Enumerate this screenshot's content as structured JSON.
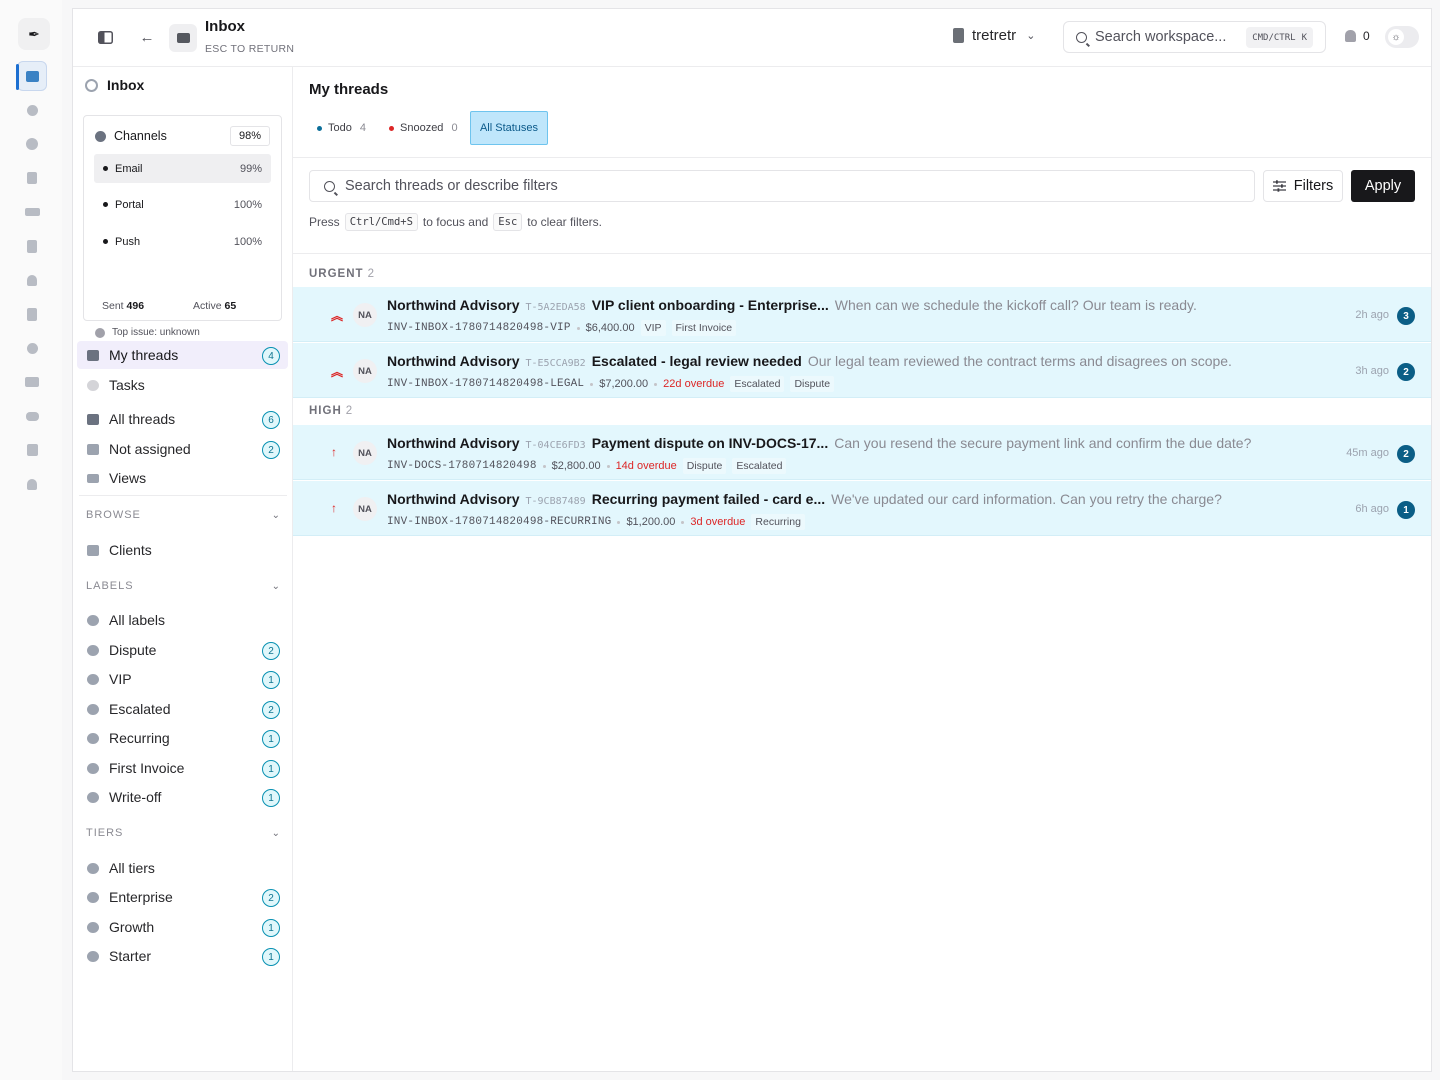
{
  "rail": {
    "logo": "✒",
    "items": [
      {
        "name": "inbox",
        "active": true
      },
      {
        "name": "wand"
      },
      {
        "name": "globe"
      },
      {
        "name": "copy"
      },
      {
        "name": "card"
      },
      {
        "name": "document"
      },
      {
        "name": "bell"
      },
      {
        "name": "invoice"
      },
      {
        "name": "clock"
      },
      {
        "name": "folder"
      },
      {
        "name": "users"
      },
      {
        "name": "calendar"
      },
      {
        "name": "bell-2"
      }
    ]
  },
  "header": {
    "title": "Inbox",
    "subtitle": "ESC TO RETURN",
    "workspace": "tretretr",
    "search_placeholder": "Search workspace...",
    "search_kbd_mod": "CMD/CTRL",
    "search_kbd_key": "K",
    "notifications": "0"
  },
  "sidebar": {
    "title": "Inbox",
    "channels": {
      "label": "Channels",
      "percent": "98%",
      "rows": [
        {
          "label": "Email",
          "value": "99%"
        },
        {
          "label": "Portal",
          "value": "100%"
        },
        {
          "label": "Push",
          "value": "100%"
        }
      ],
      "sent_label": "Sent",
      "sent_value": "496",
      "active_label": "Active",
      "active_value": "65",
      "top_issue": "Top issue: unknown"
    },
    "nav": [
      {
        "label": "My threads",
        "count": "4"
      },
      {
        "label": "Tasks"
      },
      {
        "label": "All threads",
        "count": "6"
      },
      {
        "label": "Not assigned",
        "count": "2"
      },
      {
        "label": "Views"
      }
    ],
    "browse": {
      "heading": "BROWSE",
      "items": [
        {
          "label": "Clients"
        }
      ]
    },
    "labels": {
      "heading": "LABELS",
      "items": [
        {
          "label": "All labels"
        },
        {
          "label": "Dispute",
          "count": "2"
        },
        {
          "label": "VIP",
          "count": "1"
        },
        {
          "label": "Escalated",
          "count": "2"
        },
        {
          "label": "Recurring",
          "count": "1"
        },
        {
          "label": "First Invoice",
          "count": "1"
        },
        {
          "label": "Write-off",
          "count": "1"
        }
      ]
    },
    "tiers": {
      "heading": "TIERS",
      "items": [
        {
          "label": "All tiers"
        },
        {
          "label": "Enterprise",
          "count": "2"
        },
        {
          "label": "Growth",
          "count": "1"
        },
        {
          "label": "Starter",
          "count": "1"
        }
      ]
    }
  },
  "main": {
    "title": "My threads",
    "status_tabs": [
      {
        "label": "Todo",
        "count": "4",
        "color": "#0b6e99"
      },
      {
        "label": "Snoozed",
        "count": "0",
        "color": "#dc2626"
      },
      {
        "label": "All Statuses",
        "active": true
      }
    ],
    "search_placeholder": "Search threads or describe filters",
    "filters_label": "Filters",
    "apply_label": "Apply",
    "hint": {
      "press": "Press",
      "key1": "Ctrl/Cmd+S",
      "mid": "to focus and",
      "key2": "Esc",
      "end": "to clear filters."
    },
    "groups": [
      {
        "name": "URGENT",
        "count": "2",
        "threads": [
          {
            "priority_icon": "⌃",
            "avatar": "NA",
            "client": "Northwind Advisory",
            "ticket": "T-5A2EDA58",
            "subject": "VIP client onboarding - Enterprise...",
            "preview": "When can we schedule the kickoff call? Our team is ready.",
            "invoice": "INV-INBOX-1780714820498-VIP",
            "amount": "$6,400.00",
            "overdue": "",
            "tags": [
              "VIP",
              "First Invoice"
            ],
            "age": "2h ago",
            "unread": "3"
          },
          {
            "priority_icon": "⌃",
            "avatar": "NA",
            "client": "Northwind Advisory",
            "ticket": "T-E5CCA9B2",
            "subject": "Escalated - legal review needed",
            "preview": "Our legal team reviewed the contract terms and disagrees on scope.",
            "invoice": "INV-INBOX-1780714820498-LEGAL",
            "amount": "$7,200.00",
            "overdue": "22d overdue",
            "tags": [
              "Escalated",
              "Dispute"
            ],
            "age": "3h ago",
            "unread": "2"
          }
        ]
      },
      {
        "name": "HIGH",
        "count": "2",
        "threads": [
          {
            "priority_icon": "↑",
            "avatar": "NA",
            "client": "Northwind Advisory",
            "ticket": "T-04CE6FD3",
            "subject": "Payment dispute on INV-DOCS-17...",
            "preview": "Can you resend the secure payment link and confirm the due date?",
            "invoice": "INV-DOCS-1780714820498",
            "amount": "$2,800.00",
            "overdue": "14d overdue",
            "tags": [
              "Dispute",
              "Escalated"
            ],
            "age": "45m ago",
            "unread": "2"
          },
          {
            "priority_icon": "↑",
            "avatar": "NA",
            "client": "Northwind Advisory",
            "ticket": "T-9CB87489",
            "subject": "Recurring payment failed - card e...",
            "preview": "We've updated our card information. Can you retry the charge?",
            "invoice": "INV-INBOX-1780714820498-RECURRING",
            "amount": "$1,200.00",
            "overdue": "3d overdue",
            "tags": [
              "Recurring"
            ],
            "age": "6h ago",
            "unread": "1"
          }
        ]
      }
    ]
  }
}
